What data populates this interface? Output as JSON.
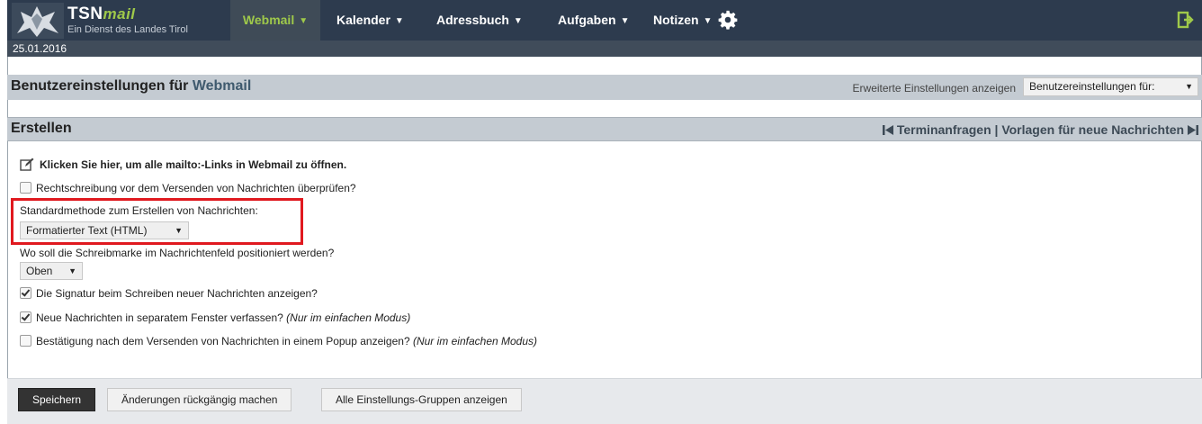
{
  "brand": {
    "name": "TSN",
    "name_suffix": "mail",
    "tagline": "Ein Dienst des Landes Tirol"
  },
  "nav": [
    {
      "label": "Webmail",
      "active": true
    },
    {
      "label": "Kalender",
      "active": false
    },
    {
      "label": "Adressbuch",
      "active": false
    },
    {
      "label": "Aufgaben",
      "active": false
    },
    {
      "label": "Notizen",
      "active": false
    }
  ],
  "icons": {
    "settings": "gear-icon",
    "logout": "logout-icon",
    "edit": "edit-icon"
  },
  "date": "25.01.2016",
  "page_header": {
    "title_prefix": "Benutzereinstellungen für",
    "title_app": "Webmail",
    "advanced_link": "Erweiterte Einstellungen anzeigen",
    "prefs_select_value": "Benutzereinstellungen für:"
  },
  "section": {
    "title": "Erstellen",
    "prev_link": "Terminanfragen",
    "separator": "|",
    "next_link": "Vorlagen für neue Nachrichten"
  },
  "options": {
    "mailto_link": "Klicken Sie hier, um alle mailto:-Links in Webmail zu öffnen.",
    "spellcheck": {
      "label": "Rechtschreibung vor dem Versenden von Nachrichten überprüfen?",
      "checked": false
    },
    "compose_method": {
      "label": "Standardmethode zum Erstellen von Nachrichten:",
      "value": "Formatierter Text (HTML)"
    },
    "cursor_position": {
      "label": "Wo soll die Schreibmarke im Nachrichtenfeld positioniert werden?",
      "value": "Oben"
    },
    "show_signature": {
      "label": "Die Signatur beim Schreiben neuer Nachrichten anzeigen?",
      "checked": true
    },
    "separate_window": {
      "label": "Neue Nachrichten in separatem Fenster verfassen?",
      "note": "(Nur im einfachen Modus)",
      "checked": true
    },
    "confirm_popup": {
      "label": "Bestätigung nach dem Versenden von Nachrichten in einem Popup anzeigen?",
      "note": "(Nur im einfachen Modus)",
      "checked": false
    }
  },
  "buttons": {
    "save": "Speichern",
    "undo": "Änderungen rückgängig machen",
    "show_all_groups": "Alle Einstellungs-Gruppen anzeigen"
  },
  "colors": {
    "topbar": "#2d3b4e",
    "brand_accent": "#9fc94a",
    "highlight": "#e0191f"
  }
}
